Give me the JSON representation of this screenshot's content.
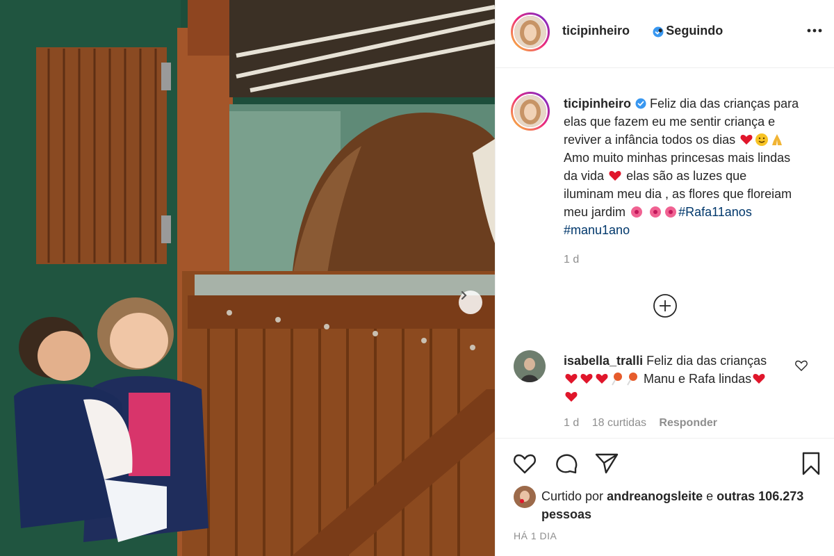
{
  "post": {
    "author": "ticipinheiro",
    "follow_status": "• Seguindo",
    "verified": true,
    "caption_text": "Feliz dia das crianças para elas que fazem eu me sentir criança e reviver a infância todos os dias",
    "caption_emojis_1": [
      "heart",
      "smiley",
      "pray"
    ],
    "caption_text_2": "Amo muito minhas princesas mais lindas da vida",
    "caption_emojis_2": [
      "heart"
    ],
    "caption_text_3": "elas são as luzes que iluminam meu dia , as flores que floreiam meu jardim",
    "caption_emojis_3": [
      "hibiscus",
      "hibiscus",
      "hibiscus"
    ],
    "hashtags": [
      "#Rafa11anos",
      "#manu1ano"
    ],
    "caption_time": "1 d"
  },
  "comment": {
    "username": "isabella_tralli",
    "text_1": "Feliz dia das crianças",
    "emojis": [
      "heart",
      "heart",
      "heart",
      "lollipop",
      "lollipop"
    ],
    "text_2": "Manu e Rafa lindas",
    "emojis_2": [
      "heart",
      "heart"
    ],
    "time": "1 d",
    "likes": "18 curtidas",
    "reply": "Responder"
  },
  "likes": {
    "prefix": "Curtido por",
    "user": "andreanogsleite",
    "conjunction": "e",
    "others": "outras 106.273 pessoas"
  },
  "date": "HÁ 1 DIA",
  "icons": {
    "like": "heart-outline-icon",
    "comment": "comment-bubble-icon",
    "share": "paper-plane-icon",
    "save": "bookmark-icon",
    "more": "more-dots-icon",
    "load_more": "plus-circle-icon",
    "next": "chevron-right-icon"
  },
  "colors": {
    "verified": "#3897f0",
    "hashtag": "#00376b",
    "muted": "#8e8e8e",
    "text": "#262626"
  }
}
